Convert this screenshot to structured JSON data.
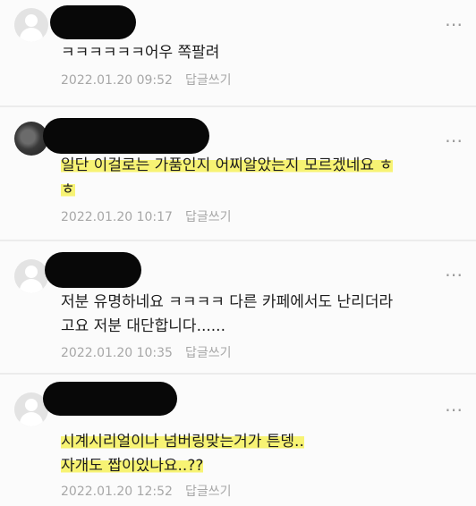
{
  "comments": [
    {
      "lines": [
        "ㅋㅋㅋㅋㅋㅋ어우 쪽팔려"
      ],
      "timestamp": "2022.01.20 09:52",
      "reply_label": "답글쓰기",
      "more_icon": "⋯",
      "avatar": "default"
    },
    {
      "lines": [
        "일단 이걸로는 가품인지 어찌알았는지 모르겠네요 ㅎ",
        "ㅎ"
      ],
      "timestamp": "2022.01.20 10:17",
      "reply_label": "답글쓰기",
      "more_icon": "⋯",
      "avatar": "photo"
    },
    {
      "lines": [
        "저분 유명하네요 ㅋㅋㅋㅋ 다른 카페에서도 난리더라",
        "고요 저분 대단합니다......"
      ],
      "timestamp": "2022.01.20 10:35",
      "reply_label": "답글쓰기",
      "more_icon": "⋯",
      "avatar": "default"
    },
    {
      "lines": [
        "시계시리얼이나 넘버링맞는거가 튼뎅..",
        "자개도 짭이있나요..??"
      ],
      "timestamp": "2022.01.20 12:52",
      "reply_label": "답글쓰기",
      "more_icon": "⋯",
      "avatar": "default"
    }
  ],
  "highlight_color": "#f6f046"
}
